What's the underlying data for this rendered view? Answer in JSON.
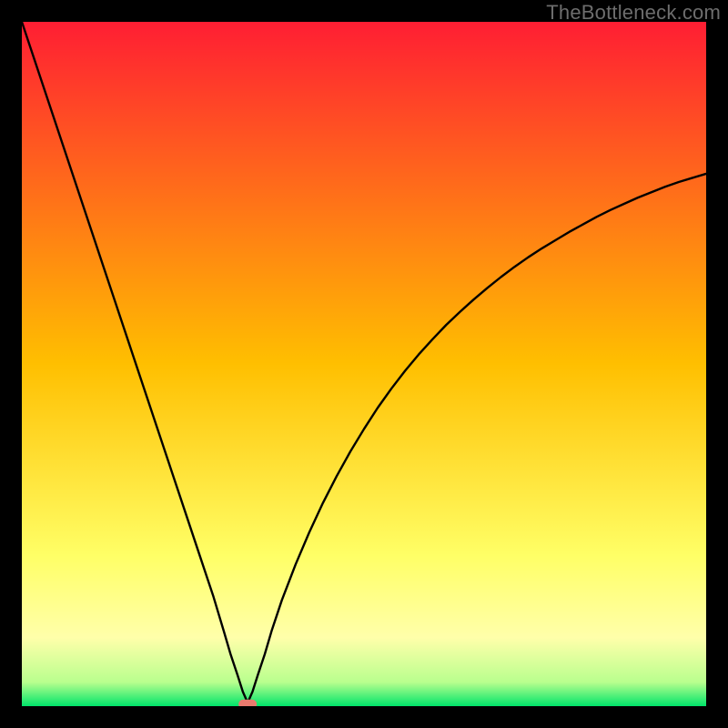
{
  "watermark": "TheBottleneck.com",
  "chart_data": {
    "type": "line",
    "title": "",
    "xlabel": "",
    "ylabel": "",
    "xlim": [
      0,
      100
    ],
    "ylim": [
      0,
      100
    ],
    "background_gradient": {
      "stops": [
        {
          "offset": 0.0,
          "color": "#ff1e33"
        },
        {
          "offset": 0.5,
          "color": "#ffbf00"
        },
        {
          "offset": 0.78,
          "color": "#ffff66"
        },
        {
          "offset": 0.9,
          "color": "#ffffaa"
        },
        {
          "offset": 0.965,
          "color": "#b9ff8e"
        },
        {
          "offset": 1.0,
          "color": "#00e46a"
        }
      ]
    },
    "series": [
      {
        "name": "bottleneck-curve",
        "description": "V-shaped curve: steep left arm descending from top-left to a minimum near x≈33, steep right arm ascending with diminishing slope toward x=100 at roughly y≈77.",
        "minimum_x": 33,
        "color": "#000000",
        "x": [
          0,
          2,
          4,
          6,
          8,
          10,
          12,
          14,
          16,
          18,
          20,
          22,
          24,
          26,
          28,
          29.5,
          30.5,
          31.5,
          32.3,
          33,
          33.7,
          34.5,
          35.5,
          36.5,
          38,
          40,
          42,
          44,
          46,
          48,
          50,
          52,
          54,
          56,
          58,
          60,
          62,
          64,
          66,
          68,
          70,
          72,
          74,
          76,
          78,
          80,
          82,
          84,
          86,
          88,
          90,
          92,
          94,
          96,
          98,
          100
        ],
        "y": [
          100,
          94,
          88,
          82,
          76,
          70,
          64,
          58,
          52,
          46,
          40,
          34,
          28,
          22,
          16,
          11,
          7.6,
          4.6,
          2.1,
          0.5,
          2.1,
          4.6,
          7.6,
          11,
          15.5,
          20.7,
          25.4,
          29.7,
          33.6,
          37.2,
          40.5,
          43.6,
          46.4,
          49,
          51.4,
          53.6,
          55.7,
          57.6,
          59.4,
          61.1,
          62.7,
          64.2,
          65.6,
          66.9,
          68.1,
          69.3,
          70.4,
          71.5,
          72.5,
          73.4,
          74.3,
          75.1,
          75.9,
          76.6,
          77.2,
          77.8
        ]
      }
    ],
    "marker": {
      "name": "min-marker",
      "x": 33,
      "y": 0.3,
      "color": "#e97a6e",
      "shape": "pill"
    }
  }
}
